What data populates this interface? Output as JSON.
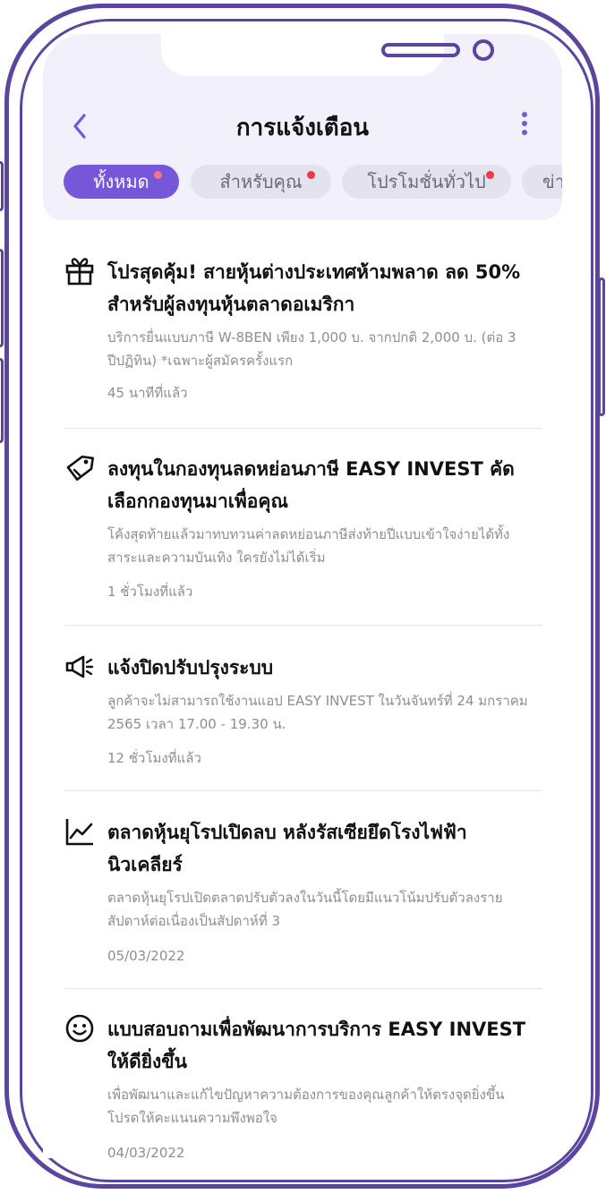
{
  "header": {
    "title": "การแจ้งเตือน",
    "back_icon": "chevron-left-icon",
    "more_icon": "more-vertical-icon",
    "accent_color": "#7656d9"
  },
  "tabs": [
    {
      "label": "ทั้งหมด",
      "active": true,
      "has_dot": true
    },
    {
      "label": "สำหรับคุณ",
      "active": false,
      "has_dot": true
    },
    {
      "label": "โปรโมชั่นทั่วไป",
      "active": false,
      "has_dot": true
    },
    {
      "label": "ข่า",
      "active": false,
      "has_dot": false
    }
  ],
  "notifications": [
    {
      "icon": "gift-icon",
      "title": "โปรสุดคุ้ม! สายหุ้นต่างประเทศห้ามพลาด ลด 50% สำหรับผู้ลงทุนหุ้นตลาดอเมริกา",
      "description": "บริการยื่นแบบภาษี W-8BEN เพียง 1,000 บ. จากปกติ 2,000 บ. (ต่อ 3 ปีปฏิทิน) *เฉพาะผู้สมัครครั้งแรก",
      "time": "45 นาทีที่แล้ว"
    },
    {
      "icon": "tag-icon",
      "title": "ลงทุนในกองทุนลดหย่อนภาษี EASY INVEST คัดเลือกกองทุนมาเพื่อคุณ",
      "description": "โค้งสุดท้ายแล้วมาทบทวนค่าลดหย่อนภาษีส่งท้ายปีแบบเข้าใจง่ายได้ทั้งสาระและความบันเทิง ใครยังไม่ได้เริ่ม",
      "time": "1 ชั่วโมงที่แล้ว"
    },
    {
      "icon": "megaphone-icon",
      "title": "แจ้งปิดปรับปรุงระบบ",
      "description": "ลูกค้าจะไม่สามารถใช้งานแอป EASY INVEST ในวันจันทร์ที่ 24 มกราคม 2565 เวลา 17.00 - 19.30 น.",
      "time": "12 ชั่วโมงที่แล้ว"
    },
    {
      "icon": "trend-chart-icon",
      "title": "ตลาดหุ้นยุโรปเปิดลบ หลังรัสเซียยึดโรงไฟฟ้านิวเคลียร์",
      "description": "ตลาดหุ้นยุโรปเปิดตลาดปรับตัวลงในวันนี้โดยมีแนวโน้มปรับตัวลงรายสัปดาห์ต่อเนื่องเป็นสัปดาห์ที่ 3",
      "time": "05/03/2022"
    },
    {
      "icon": "smile-icon",
      "title": "แบบสอบถามเพื่อพัฒนาการบริการ EASY INVEST ให้ดียิ่งขึ้น",
      "description": "เพื่อพัฒนาและแก้ไขปัญหาความต้องการของคุณลูกค้าให้ตรงจุดยิ่งขึ้น โปรดให้คะแนนความพึงพอใจ",
      "time": "04/03/2022"
    }
  ]
}
